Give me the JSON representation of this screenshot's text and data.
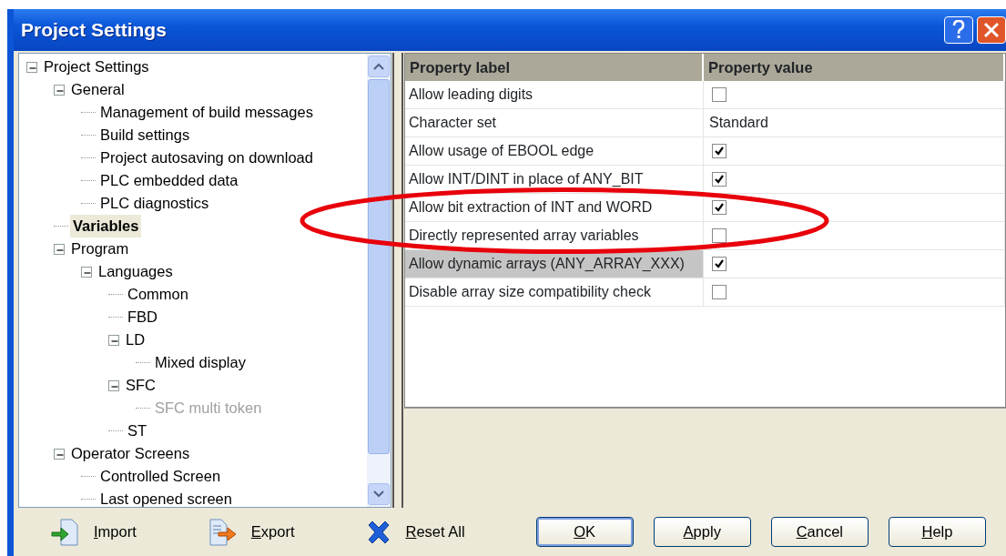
{
  "window": {
    "title": "Project Settings"
  },
  "tree": [
    {
      "label": "Project Settings",
      "expanded": true,
      "selected": false,
      "disabled": false,
      "children": [
        {
          "label": "General",
          "expanded": true,
          "selected": false,
          "disabled": false,
          "children": [
            {
              "label": "Management of build messages",
              "selected": false,
              "disabled": false
            },
            {
              "label": "Build settings",
              "selected": false,
              "disabled": false
            },
            {
              "label": "Project autosaving on download",
              "selected": false,
              "disabled": false
            },
            {
              "label": "PLC embedded data",
              "selected": false,
              "disabled": false
            },
            {
              "label": "PLC diagnostics",
              "selected": false,
              "disabled": false
            }
          ]
        },
        {
          "label": "Variables",
          "selected": true,
          "disabled": false
        },
        {
          "label": "Program",
          "expanded": true,
          "selected": false,
          "disabled": false,
          "children": [
            {
              "label": "Languages",
              "expanded": true,
              "selected": false,
              "disabled": false,
              "children": [
                {
                  "label": "Common",
                  "selected": false,
                  "disabled": false
                },
                {
                  "label": "FBD",
                  "selected": false,
                  "disabled": false
                },
                {
                  "label": "LD",
                  "expanded": true,
                  "selected": false,
                  "disabled": false,
                  "children": [
                    {
                      "label": "Mixed display",
                      "selected": false,
                      "disabled": false
                    }
                  ]
                },
                {
                  "label": "SFC",
                  "expanded": true,
                  "selected": false,
                  "disabled": false,
                  "children": [
                    {
                      "label": "SFC multi token",
                      "selected": false,
                      "disabled": true
                    }
                  ]
                },
                {
                  "label": "ST",
                  "selected": false,
                  "disabled": false
                }
              ]
            }
          ]
        },
        {
          "label": "Operator Screens",
          "expanded": true,
          "selected": false,
          "disabled": false,
          "children": [
            {
              "label": "Controlled Screen",
              "selected": false,
              "disabled": false
            },
            {
              "label": "Last opened screen",
              "selected": false,
              "disabled": false
            }
          ]
        }
      ]
    }
  ],
  "table": {
    "columns": [
      "Property label",
      "Property value"
    ],
    "rows": [
      {
        "label": "Allow leading digits",
        "kind": "checkbox",
        "checked": false,
        "selected": false
      },
      {
        "label": "Character set",
        "kind": "text",
        "value": "Standard",
        "selected": false
      },
      {
        "label": "Allow usage of EBOOL edge",
        "kind": "checkbox",
        "checked": true,
        "selected": false
      },
      {
        "label": "Allow INT/DINT in place of ANY_BIT",
        "kind": "checkbox",
        "checked": true,
        "selected": false
      },
      {
        "label": "Allow bit extraction of INT and WORD",
        "kind": "checkbox",
        "checked": true,
        "selected": false
      },
      {
        "label": "Directly represented array variables",
        "kind": "checkbox",
        "checked": false,
        "selected": false
      },
      {
        "label": "Allow dynamic arrays (ANY_ARRAY_XXX)",
        "kind": "checkbox",
        "checked": true,
        "selected": true
      },
      {
        "label": "Disable array size compatibility check",
        "kind": "checkbox",
        "checked": false,
        "selected": false
      }
    ]
  },
  "highlight": {
    "kind": "ellipse"
  },
  "tools": [
    {
      "kind": "import",
      "key": "I",
      "rest": "mport"
    },
    {
      "kind": "export",
      "key": "E",
      "rest": "xport"
    },
    {
      "kind": "reset",
      "key": "R",
      "rest": "eset All"
    }
  ],
  "buttons": [
    {
      "key": "O",
      "rest": "K",
      "default": true
    },
    {
      "key": "A",
      "rest": "pply",
      "default": false
    },
    {
      "key": "C",
      "rest": "ancel",
      "default": false
    },
    {
      "key": "H",
      "rest": "elp",
      "default": false
    }
  ]
}
